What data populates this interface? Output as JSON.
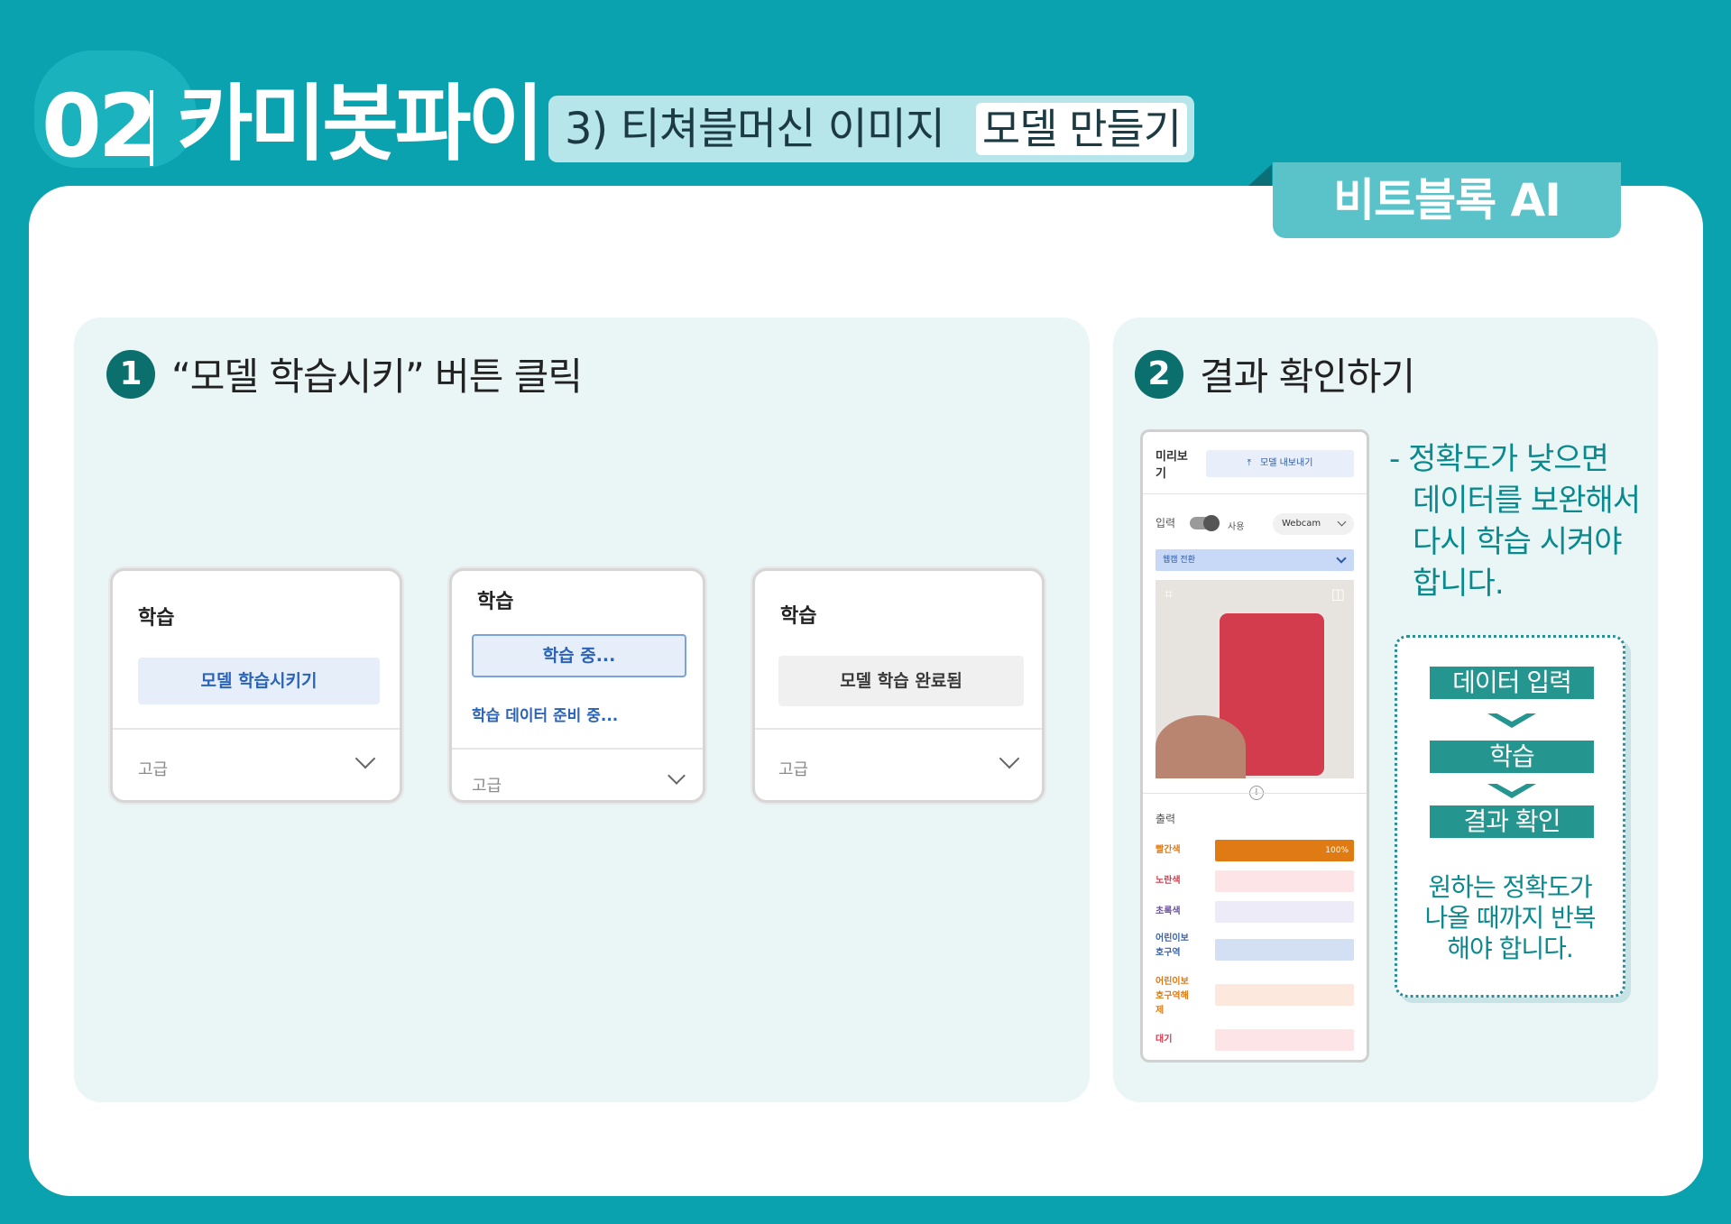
{
  "header": {
    "number": "02",
    "title": "카미봇파이",
    "subtitle": "3) 티쳐블머신 이미지",
    "subtitle_highlight": "모델 만들기",
    "tab": "비트블록 AI"
  },
  "step1": {
    "number": "1",
    "label": "“모델 학습시키” 버튼 클릭",
    "cards": [
      {
        "heading": "학습",
        "button": "모델 학습시키기",
        "advanced": "고급"
      },
      {
        "heading": "학습",
        "button": "학습 중...",
        "status": "학습 데이터 준비 중...",
        "advanced": "고급"
      },
      {
        "heading": "학습",
        "button": "모델 학습 완료됨",
        "advanced": "고급"
      }
    ]
  },
  "step2": {
    "number": "2",
    "label": "결과 확인하기",
    "preview": {
      "title_line1": "미리보",
      "title_line2": "기",
      "export_button": "모델 내보내기",
      "input_label": "입력",
      "toggle_label": "사용",
      "source_select": "Webcam",
      "switch_webcam": "웹캠 전환",
      "output_label": "출력",
      "outputs": [
        {
          "name": "빨간색",
          "value": 100,
          "percent_label": "100%",
          "color": "#e07a12",
          "bg": "#e07a12"
        },
        {
          "name": "노란색",
          "value": 0,
          "color": "#d63b4e",
          "bg": "#fde4e7"
        },
        {
          "name": "초록색",
          "value": 0,
          "color": "#6a4f9a",
          "bg": "#ecebf7"
        },
        {
          "name_line1": "어린이보",
          "name_line2": "호구역",
          "value": 0,
          "color": "#3b63a8",
          "bg": "#d3e0f3"
        },
        {
          "name_line1": "어린이보",
          "name_line2": "호구역해",
          "name_line3": "제",
          "value": 0,
          "color": "#e07a12",
          "bg": "#fde8de"
        },
        {
          "name": "대기",
          "value": 0,
          "color": "#d63b4e",
          "bg": "#fde4e7"
        }
      ]
    },
    "note_lines": [
      "- 정확도가 낮으면",
      "데이터를 보완해서",
      "다시 학습 시켜야",
      "합니다."
    ],
    "flow": {
      "steps": [
        "데이터 입력",
        "학습",
        "결과 확인"
      ],
      "caption_lines": [
        "원하는 정확도가",
        "나올 때까지 반복",
        "해야 합니다."
      ]
    }
  },
  "colors": {
    "background": "#0aa2ae",
    "panel": "#eaf5f5",
    "accent_dark": "#0b6f6e",
    "flow_bar": "#24968f",
    "tab": "#5ac3c9"
  }
}
